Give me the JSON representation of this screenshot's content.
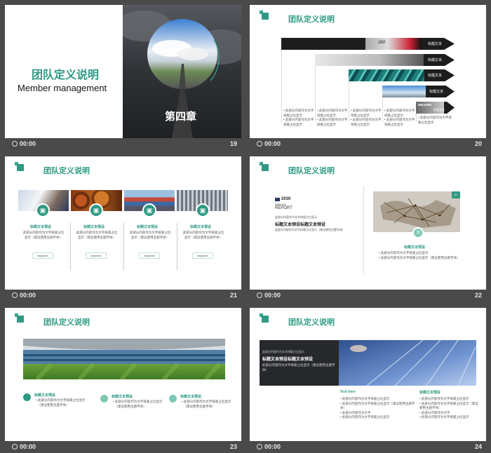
{
  "slide19": {
    "title_cn": "团队定义说明",
    "title_en": "Member management",
    "chapter": "第四章",
    "time": "00:00",
    "num": "19"
  },
  "slide20": {
    "title": "团队定义说明",
    "bars": [
      "标题文本",
      "标题文本",
      "标题文本",
      "标题文本",
      "标题文本"
    ],
    "col_text": [
      "此部分内容作为文字排版占位显示",
      "此部分内容作为文字排版占位显示",
      "此部分内容作为文字排版占位显示",
      "此部分内容作为文字排版占位显示",
      "此部分内容作为文字排版占位显示"
    ],
    "img_text_1": "260",
    "img_text_2": "666,000K",
    "time": "00:00",
    "num": "20"
  },
  "slide21": {
    "title": "团队定义说明",
    "items": [
      {
        "heading": "标题文本预设",
        "body": "此部分内容作为文字排版占位显示（建议使用主题字体）",
        "keyword": "keyword"
      },
      {
        "heading": "标题文本预设",
        "body": "此部分内容作为文字排版占位显示（建议使用主题字体）",
        "keyword": "keyword"
      },
      {
        "heading": "标题文本预设",
        "body": "此部分内容作为文字排版占位显示（建议使用主题字体）",
        "keyword": "keyword"
      },
      {
        "heading": "标题文本预设",
        "body": "此部分内容作为文字排版占位显示（建议使用主题字体）",
        "keyword": "keyword"
      }
    ],
    "time": "00:00",
    "num": "21"
  },
  "slide22": {
    "title": "团队定义说明",
    "report_year": "2030",
    "report_l1": "ANNUAL",
    "report_l2": "REPORT",
    "small_1": "此部分内容作为文字排版占位显示",
    "heading": "标题文本预设标题文本预设",
    "small_2": "此部分内容作为文字排版占位显示（建议使用主题字体）",
    "right_heading": "标题文本预设",
    "bullets": [
      "此部分内容作为文字排版占位显示",
      "（建议使用主题字体）"
    ],
    "badge": "01",
    "time": "00:00",
    "num": "22"
  },
  "slide23": {
    "title": "团队定义说明",
    "items": [
      {
        "heading": "标题文本预设",
        "body": [
          "此部分内容作为文字排版占位显示",
          "（建议使用主题字体）"
        ]
      },
      {
        "heading": "标题文本预设",
        "body": [
          "此部分内容作为文字排版占位显示",
          "（建议使用主题字体）"
        ]
      },
      {
        "heading": "标题文本预设",
        "body": [
          "此部分内容作为文字排版占位显示",
          "（建议使用主题字体）"
        ]
      }
    ],
    "time": "00:00",
    "num": "23"
  },
  "slide24": {
    "title": "团队定义说明",
    "dark_small": "此部分内容作为文字排版占位显示",
    "dark_heading": "标题文本预设标题文本预设",
    "dark_body": "此部分内容作为文字排版占位显示（建议使用主题字体）",
    "col1_heading": "Text here",
    "col1_bullets": [
      "此部分内容作为文字排版占位显示",
      "此部分内容作为文字排版占位显示（建议使用主题字体）",
      "此部分内容作为文字",
      "此部分内容作为文字排版占位显示"
    ],
    "col2_heading": "标题文本预设",
    "col2_bullets": [
      "此部分内容作为文字排版占位显示",
      "此部分内容作为文字排版占位显示（建议使用主题字体）",
      "此部分内容作为文字",
      "此部分内容作为文字排版占位显示"
    ],
    "time": "00:00",
    "num": "24"
  },
  "colors": {
    "accent": "#2f9a84",
    "background": "#4a4a4a"
  }
}
